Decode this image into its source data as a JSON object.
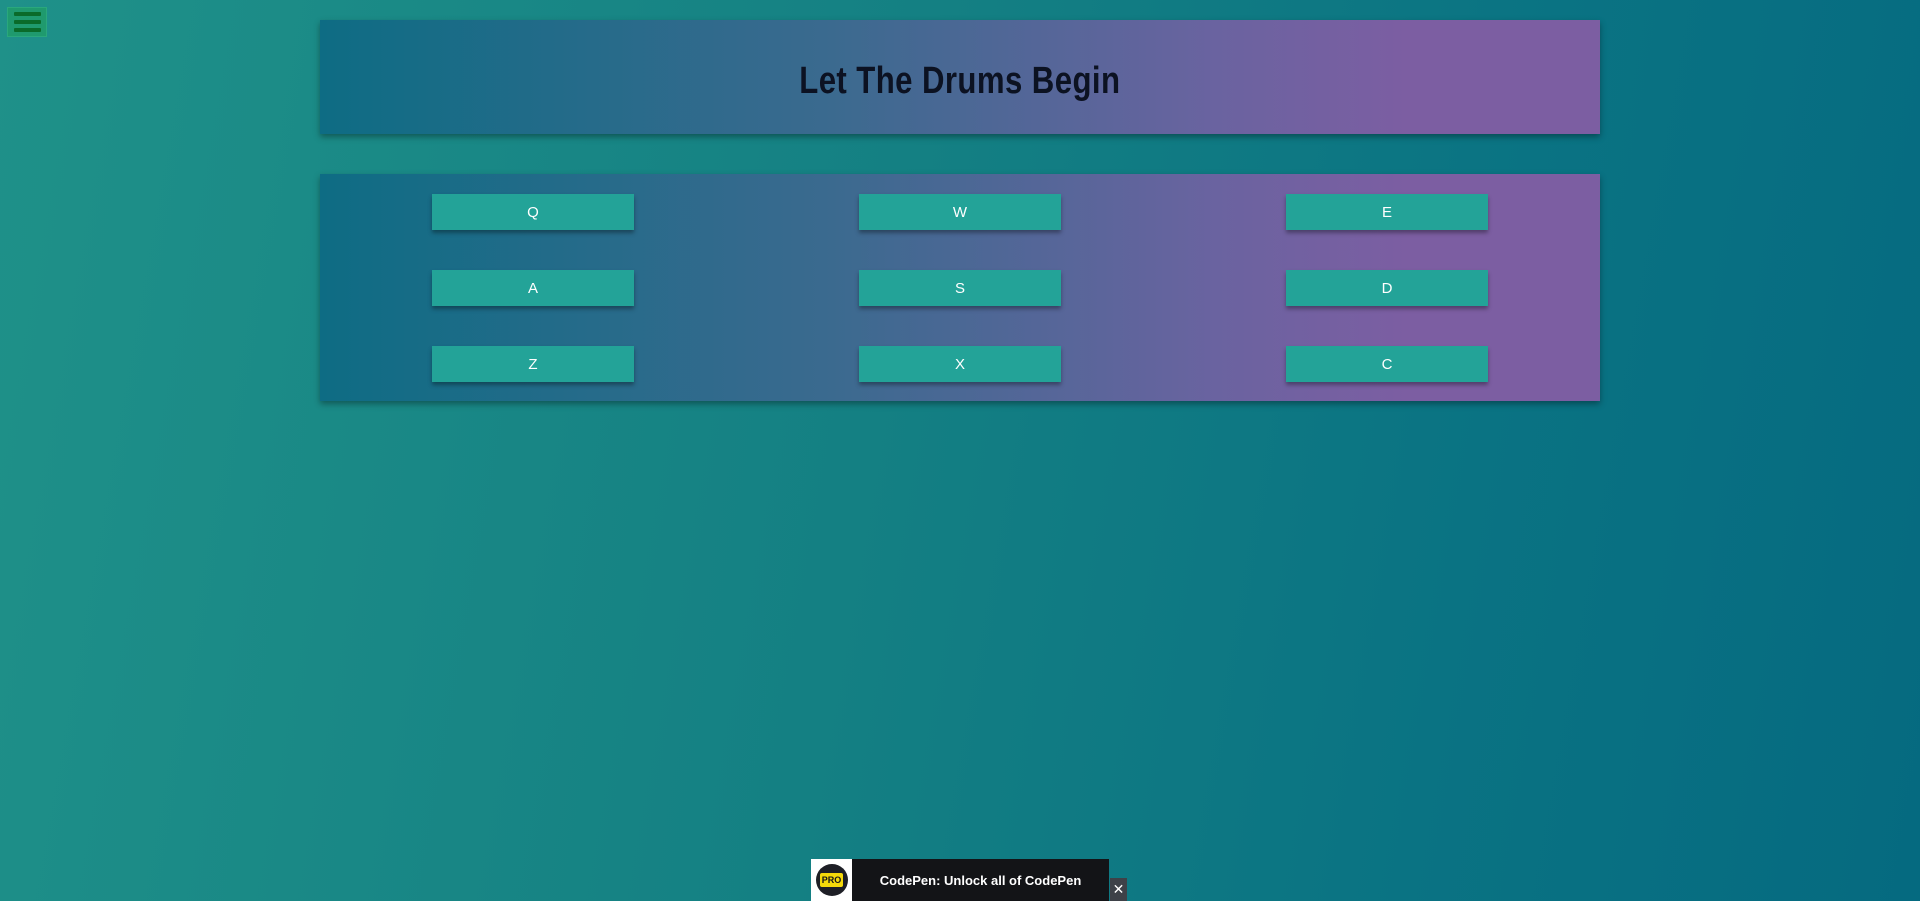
{
  "menu": {
    "icon": "hamburger-menu-icon"
  },
  "header": {
    "title": "Let The Drums Begin"
  },
  "pads": [
    {
      "key": "Q"
    },
    {
      "key": "W"
    },
    {
      "key": "E"
    },
    {
      "key": "A"
    },
    {
      "key": "S"
    },
    {
      "key": "D"
    },
    {
      "key": "Z"
    },
    {
      "key": "X"
    },
    {
      "key": "C"
    }
  ],
  "promo": {
    "badge": "PRO",
    "text": "CodePen: Unlock all of CodePen",
    "close": "✕"
  },
  "colors": {
    "pad": "#23a398",
    "title": "#0c1222",
    "panel_start": "#0e6c84",
    "panel_end": "#7c5ea2"
  }
}
